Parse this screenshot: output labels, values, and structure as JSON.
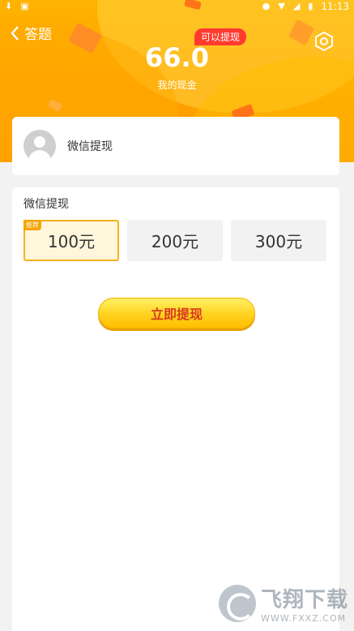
{
  "status_bar": {
    "time": "11:13"
  },
  "nav": {
    "back_label": "答题"
  },
  "header": {
    "badge": "可以提现",
    "amount": "66.0",
    "amount_label": "我的现金"
  },
  "account": {
    "name": "微信提现"
  },
  "withdraw": {
    "title": "微信提现",
    "options": [
      {
        "label": "100元",
        "tag": "推荐",
        "selected": true
      },
      {
        "label": "200元",
        "selected": false
      },
      {
        "label": "300元",
        "selected": false
      }
    ],
    "submit_label": "立即提现"
  },
  "watermark": {
    "cn": "飞翔下载",
    "en": "WWW.FXXZ.COM"
  },
  "colors": {
    "header": "#ffa000",
    "accent": "#f5b21c",
    "badge": "#ff3b2f",
    "cta_text": "#d63a1e"
  }
}
